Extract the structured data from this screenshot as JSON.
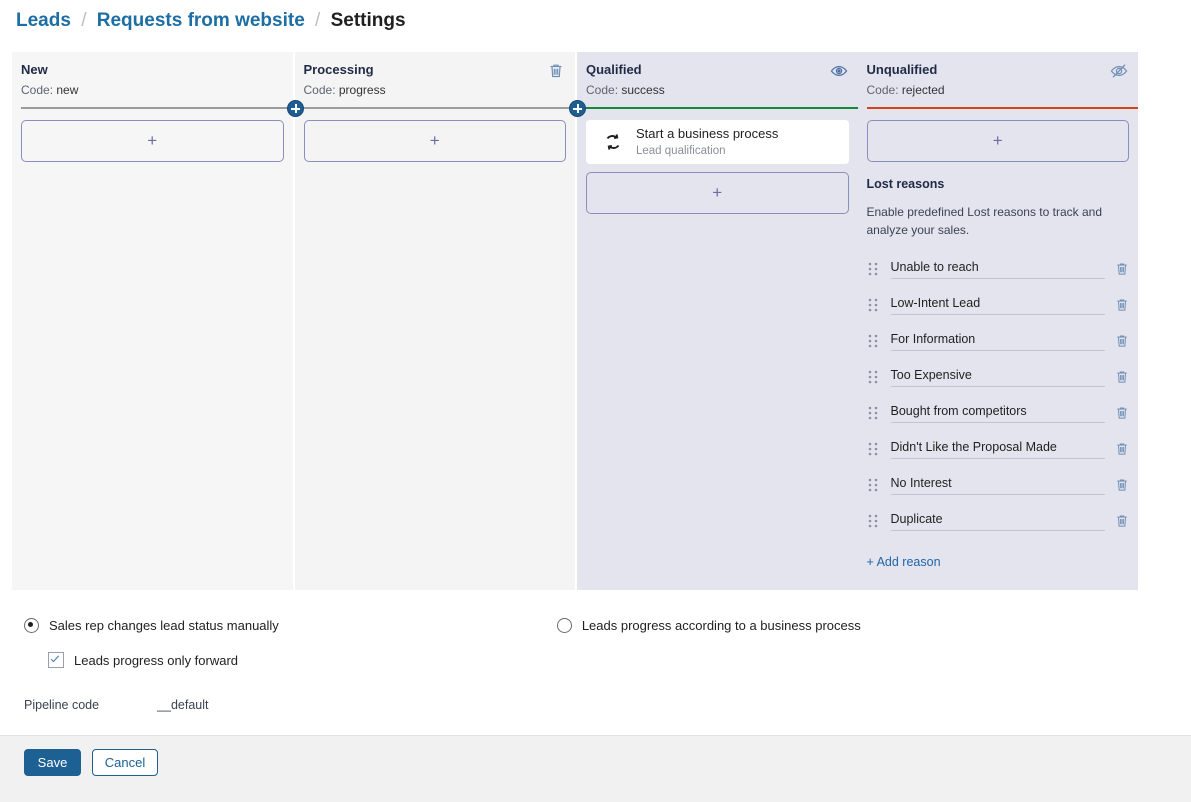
{
  "breadcrumb": {
    "items": [
      {
        "label": "Leads",
        "current": false
      },
      {
        "label": "Requests from website",
        "current": false
      },
      {
        "label": "Settings",
        "current": true
      }
    ],
    "separator": "/"
  },
  "board": {
    "columns": [
      {
        "title": "New",
        "code_label": "Code:",
        "code_value": "new",
        "rule_color": "#9c9c9c",
        "header_icon": "",
        "add_card_label": "+",
        "connector": false
      },
      {
        "title": "Processing",
        "code_label": "Code:",
        "code_value": "progress",
        "rule_color": "#9c9c9c",
        "header_icon": "trash-icon",
        "add_card_label": "+",
        "connector": true
      },
      {
        "title": "Qualified",
        "code_label": "Code:",
        "code_value": "success",
        "rule_color": "#18883a",
        "header_icon": "eye-icon",
        "add_card_label": "+",
        "connector": true,
        "process_card": {
          "title": "Start a business process",
          "subtitle": "Lead qualification",
          "icon": "business-process-icon"
        }
      },
      {
        "title": "Unqualified",
        "code_label": "Code:",
        "code_value": "rejected",
        "rule_color": "#d94215",
        "header_icon": "eye-off-icon",
        "add_card_label": "+",
        "connector": false
      }
    ]
  },
  "lost_reasons": {
    "title": "Lost reasons",
    "description": "Enable predefined Lost reasons to track and analyze your sales.",
    "items": [
      "Unable to reach",
      "Low-Intent Lead",
      "For Information",
      "Too Expensive",
      "Bought from competitors",
      "Didn't Like the Proposal Made",
      "No Interest",
      "Duplicate"
    ],
    "add_label": "+ Add reason"
  },
  "options": {
    "radio_manual": {
      "label": "Sales rep changes lead status manually",
      "selected": true
    },
    "radio_process": {
      "label": "Leads progress according to a business process",
      "selected": false
    },
    "checkbox_forward": {
      "label": "Leads progress only forward",
      "checked": true
    },
    "pipeline_code_label": "Pipeline code",
    "pipeline_code_value": "__default"
  },
  "footer": {
    "save_label": "Save",
    "cancel_label": "Cancel"
  }
}
